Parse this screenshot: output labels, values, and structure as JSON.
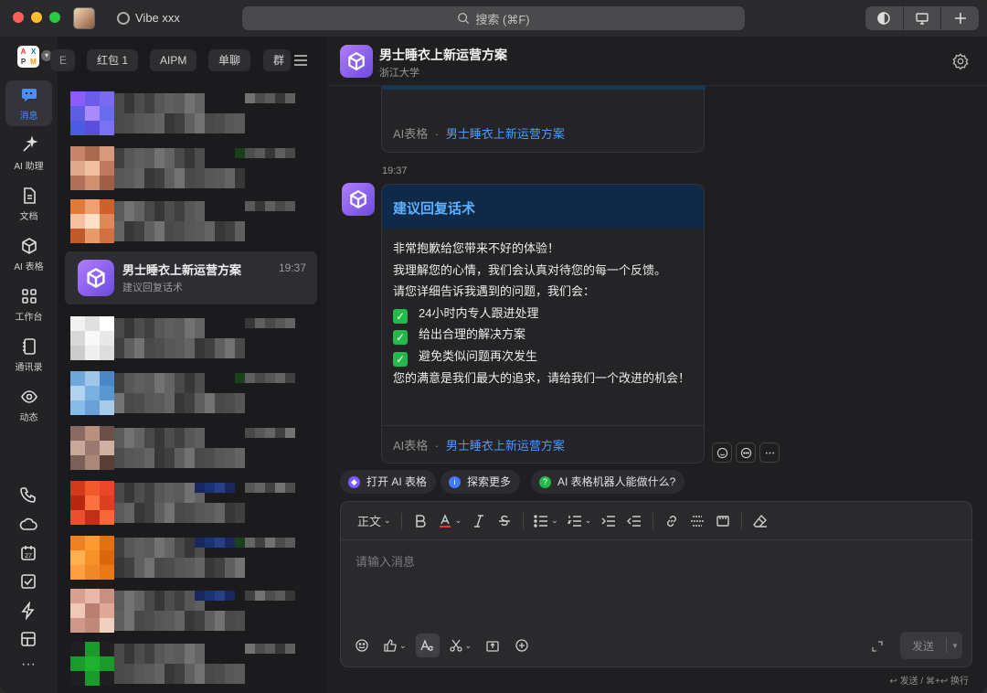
{
  "titlebar": {
    "workspace": "Vibe xxx",
    "search_placeholder": "搜索 (⌘F)"
  },
  "nav": {
    "items": [
      {
        "label": "消息",
        "icon": "message-icon"
      },
      {
        "label": "AI 助理",
        "icon": "sparkle-icon"
      },
      {
        "label": "文档",
        "icon": "document-icon"
      },
      {
        "label": "AI 表格",
        "icon": "cube-icon"
      },
      {
        "label": "工作台",
        "icon": "grid-icon"
      },
      {
        "label": "通讯录",
        "icon": "contacts-icon"
      },
      {
        "label": "动态",
        "icon": "eye-icon"
      }
    ],
    "calendar_day": "27"
  },
  "list": {
    "filters": [
      "E",
      "红包 1",
      "AIPM",
      "单聊",
      "群聊"
    ],
    "selected": {
      "title": "男士睡衣上新运营方案",
      "time": "19:37",
      "subtitle": "建议回复话术"
    }
  },
  "chat": {
    "title": "男士睡衣上新运营方案",
    "subtitle": "浙江大学",
    "prev_card_footer": {
      "source": "AI表格",
      "sep": "·",
      "link": "男士睡衣上新运营方案"
    },
    "time": "19:37",
    "card": {
      "header": "建议回复话术",
      "lines": [
        "非常抱歉给您带来不好的体验！",
        "我理解您的心情，我们会认真对待您的每一个反馈。",
        "请您详细告诉我遇到的问题，我们会："
      ],
      "checks": [
        "24小时内专人跟进处理",
        "给出合理的解决方案",
        "避免类似问题再次发生"
      ],
      "closing": "您的满意是我们最大的追求，请给我们一个改进的机会！",
      "footer": {
        "source": "AI表格",
        "sep": "·",
        "link": "男士睡衣上新运营方案"
      }
    },
    "quick_actions": [
      {
        "label": "打开 AI 表格",
        "color": "#7a5cff"
      },
      {
        "label": "探索更多",
        "color": "#3f7bff"
      },
      {
        "label": "AI 表格机器人能做什么?",
        "color": "#27b84a"
      }
    ]
  },
  "editor": {
    "style_label": "正文",
    "placeholder": "请输入消息",
    "send_label": "发送",
    "hint": "↩ 发送 / ⌘+↩ 换行"
  }
}
